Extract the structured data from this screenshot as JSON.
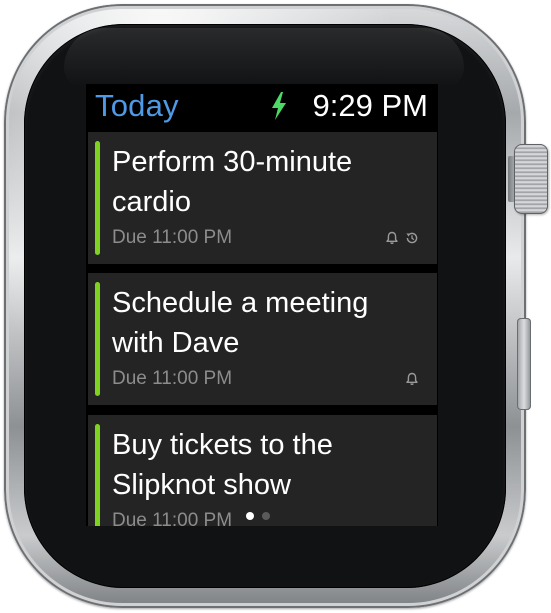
{
  "status_bar": {
    "title": "Today",
    "time": "9:29 PM"
  },
  "colors": {
    "title_accent": "#4f9ae6",
    "task_accent": "#7ed321",
    "card_background": "#242424",
    "charging_bolt": "#4cd964"
  },
  "tasks": [
    {
      "title": "Perform 30-minute cardio",
      "due": "Due 11:00 PM",
      "icons": [
        "bell-icon",
        "recurring-icon"
      ]
    },
    {
      "title": "Schedule a meeting with Dave",
      "due": "Due 11:00 PM",
      "icons": [
        "bell-icon"
      ]
    },
    {
      "title": "Buy tickets to the Slipknot show",
      "due": "Due 11:00 PM",
      "icons": []
    }
  ],
  "pagination": {
    "pages": 2,
    "current": 1
  }
}
